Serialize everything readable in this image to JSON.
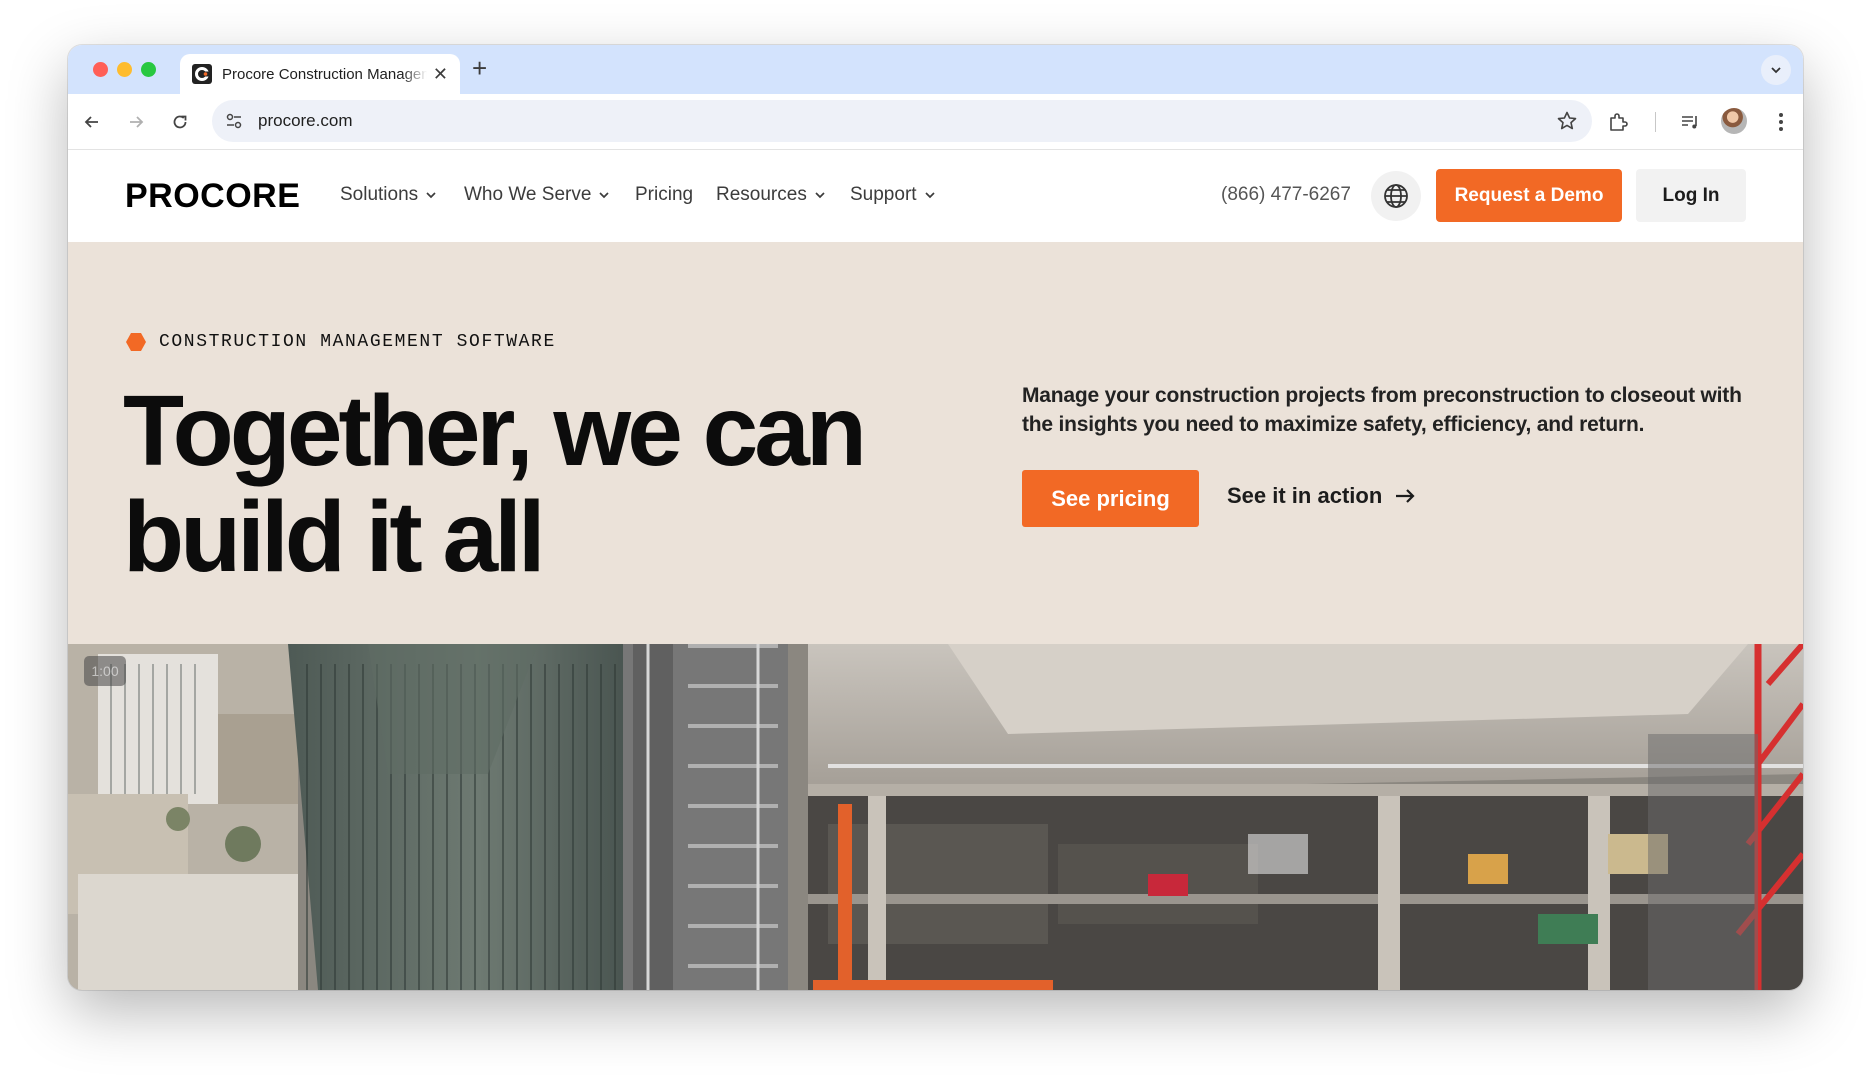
{
  "browser": {
    "tab_title": "Procore Construction Management Software",
    "url": "procore.com"
  },
  "header": {
    "logo": "PROCORE",
    "nav": [
      "Solutions",
      "Who We Serve",
      "Pricing",
      "Resources",
      "Support"
    ],
    "phone": "(866) 477-6267",
    "demo_label": "Request a Demo",
    "login_label": "Log In"
  },
  "hero": {
    "eyebrow": "CONSTRUCTION MANAGEMENT SOFTWARE",
    "headline_line1": "Together, we can",
    "headline_line2": "build it all",
    "subtext": "Manage your construction projects from preconstruction to closeout with the insights you need to maximize safety, efficiency, and return.",
    "pricing_label": "See pricing",
    "action_label": "See it in action"
  },
  "video": {
    "timestamp": "1:00"
  },
  "colors": {
    "brand_orange": "#f26925",
    "hero_bg": "#ebe2d9",
    "tab_strip": "#d3e3fd"
  }
}
